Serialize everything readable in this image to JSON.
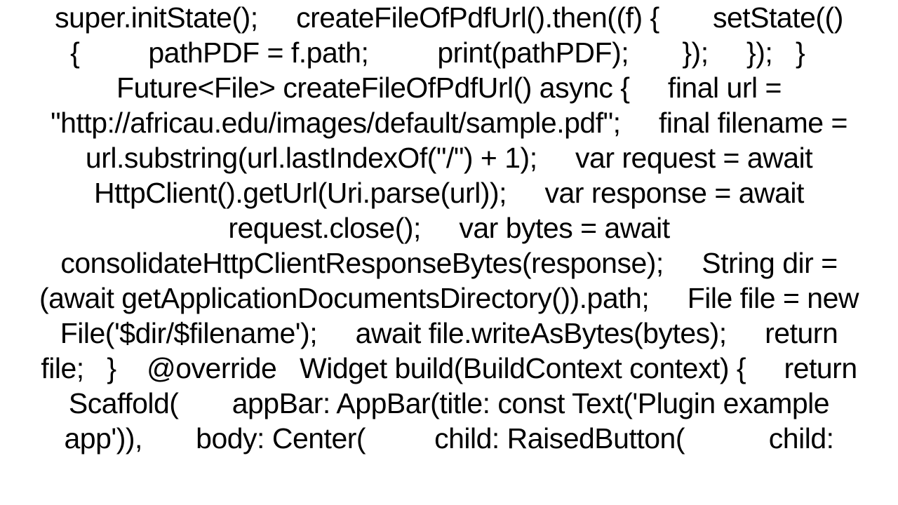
{
  "code_text": "super.initState();     createFileOfPdfUrl().then((f) {       setState(() {         pathPDF = f.path;         print(pathPDF);       });     });   }    Future<File> createFileOfPdfUrl() async {     final url = \"http://africau.edu/images/default/sample.pdf\";     final filename = url.substring(url.lastIndexOf(\"/\") + 1);     var request = await HttpClient().getUrl(Uri.parse(url));     var response = await request.close();     var bytes = await consolidateHttpClientResponseBytes(response);     String dir = (await getApplicationDocumentsDirectory()).path;     File file = new File('$dir/$filename');     await file.writeAsBytes(bytes);     return file;   }    @override   Widget build(BuildContext context) {     return Scaffold(       appBar: AppBar(title: const Text('Plugin example app')),       body: Center(         child: RaisedButton(           child:"
}
